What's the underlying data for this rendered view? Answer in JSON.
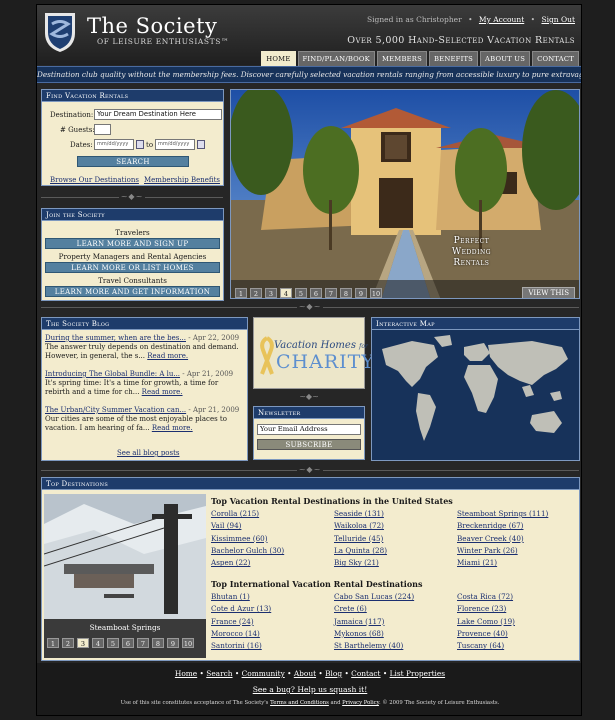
{
  "header": {
    "title": "The Society",
    "subtitle": "of Leisure Enthusiasts™",
    "signed_in": "Signed in as Christopher",
    "my_account": "My Account",
    "sign_out": "Sign Out",
    "tagline": "Over 5,000 Hand-Selected Vacation Rentals"
  },
  "nav": {
    "tabs": [
      "HOME",
      "FIND/PLAN/BOOK",
      "MEMBERS",
      "BENEFITS",
      "ABOUT US",
      "CONTACT"
    ],
    "active": "HOME"
  },
  "banner": "Destination club quality without the membership fees. Discover carefully selected vacation rentals ranging from accessible luxury to pure extravagance.",
  "find": {
    "title": "Find Vacation Rentals",
    "destination_label": "Destination:",
    "destination_value": "Your Dream Destination Here",
    "guests_label": "# Guests:",
    "guests_value": "",
    "dates_label": "Dates:",
    "date_from": "mm/dd/yyyy",
    "date_to": "mm/dd/yyyy",
    "to_label": "to",
    "search_button": "SEARCH",
    "browse_link": "Browse Our Destinations",
    "benefits_link": "Membership Benefits"
  },
  "join": {
    "title": "Join the Society",
    "travelers": "Travelers",
    "travelers_button": "LEARN MORE AND SIGN UP",
    "agencies": "Property Managers and Rental Agencies",
    "agencies_button": "LEARN MORE OR LIST HOMES",
    "consultants": "Travel Consultants",
    "consultants_button": "LEARN MORE AND GET INFORMATION"
  },
  "photo": {
    "caption": "Perfect\nWedding\nRentals",
    "pages": [
      "1",
      "2",
      "3",
      "4",
      "5",
      "6",
      "7",
      "8",
      "9",
      "10"
    ],
    "active_page": "4",
    "view_button": "VIEW THIS"
  },
  "blog": {
    "title": "The Society Blog",
    "posts": [
      {
        "link": "During the summer, when are the bes...",
        "date": " - Apr 22, 2009",
        "excerpt": "The answer truly depends on destination and demand. However, in general, the s...",
        "more": "Read more."
      },
      {
        "link": "Introducing The Global Bundle: A lu...",
        "date": " - Apr 21, 2009",
        "excerpt": "It's spring time: It's a time for growth, a time for rebirth and a time for ch...",
        "more": "Read more."
      },
      {
        "link": "The Urban/City Summer Vacation can...",
        "date": " - Apr 21, 2009",
        "excerpt": "Our cities are some of the most enjoyable places to vacation. I am hearing of fa...",
        "more": "Read more."
      }
    ],
    "see_all": "See all blog posts"
  },
  "charity": {
    "line1": "Vacation Homes",
    "line1b": "for",
    "line2": "Charity"
  },
  "newsletter": {
    "title": "Newsletter",
    "email_value": "Your Email Address",
    "subscribe": "SUBSCRIBE"
  },
  "map": {
    "title": "Interactive Map"
  },
  "top_destinations": {
    "title": "Top Destinations",
    "photo_caption": "Steamboat Springs",
    "pages": [
      "1",
      "2",
      "3",
      "4",
      "5",
      "6",
      "7",
      "8",
      "9",
      "10"
    ],
    "active_page": "3",
    "us_title": "Top Vacation Rental Destinations in the United States",
    "us": [
      "Corolla (215)",
      "Seaside (131)",
      "Steamboat Springs (111)",
      "Vail (94)",
      "Waikoloa (72)",
      "Breckenridge (67)",
      "Kissimmee (60)",
      "Telluride (45)",
      "Beaver Creek (40)",
      "Bachelor Gulch (30)",
      "La Quinta (28)",
      "Winter Park (26)",
      "Aspen (22)",
      "Big Sky (21)",
      "Miami (21)"
    ],
    "intl_title": "Top International Vacation Rental Destinations",
    "intl": [
      "Bhutan (1)",
      "Cabo San Lucas (224)",
      "Costa Rica (72)",
      "Cote d Azur (13)",
      "Crete (6)",
      "Florence (23)",
      "France (24)",
      "Jamaica (117)",
      "Lake Como (19)",
      "Morocco (14)",
      "Mykonos (68)",
      "Provence (40)",
      "Santorini (16)",
      "St Barthelemy (40)",
      "Tuscany (64)"
    ]
  },
  "footer": {
    "links": [
      "Home",
      "Search",
      "Community",
      "About",
      "Blog",
      "Contact",
      "List Properties"
    ],
    "bug": "See a bug? Help us squash it!",
    "legal_prefix": "Use of this site constitutes acceptance of The Society's ",
    "terms": "Terms and Conditions",
    "and": " and ",
    "privacy": "Privacy Policy",
    "legal_suffix": ". © 2009 The Society of Leisure Enthusiasts."
  },
  "colors": {
    "navy": "#17325a",
    "cream": "#f3ecce",
    "button": "#54809f",
    "background": "#262626"
  }
}
